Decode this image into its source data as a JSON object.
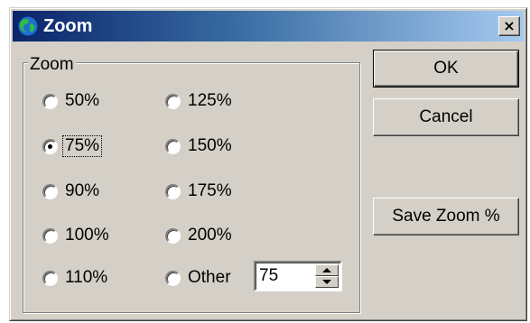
{
  "dialog": {
    "title": "Zoom",
    "close_glyph": "×",
    "title_icon": "globe-icon"
  },
  "group": {
    "legend": "Zoom",
    "options": [
      {
        "label": "50%",
        "checked": false
      },
      {
        "label": "125%",
        "checked": false
      },
      {
        "label": "75%",
        "checked": true
      },
      {
        "label": "150%",
        "checked": false
      },
      {
        "label": "90%",
        "checked": false
      },
      {
        "label": "175%",
        "checked": false
      },
      {
        "label": "100%",
        "checked": false
      },
      {
        "label": "200%",
        "checked": false
      },
      {
        "label": "110%",
        "checked": false
      },
      {
        "label": "Other",
        "checked": false
      }
    ],
    "other_value": "75"
  },
  "buttons": {
    "ok": "OK",
    "cancel": "Cancel",
    "save_zoom": "Save Zoom %"
  }
}
